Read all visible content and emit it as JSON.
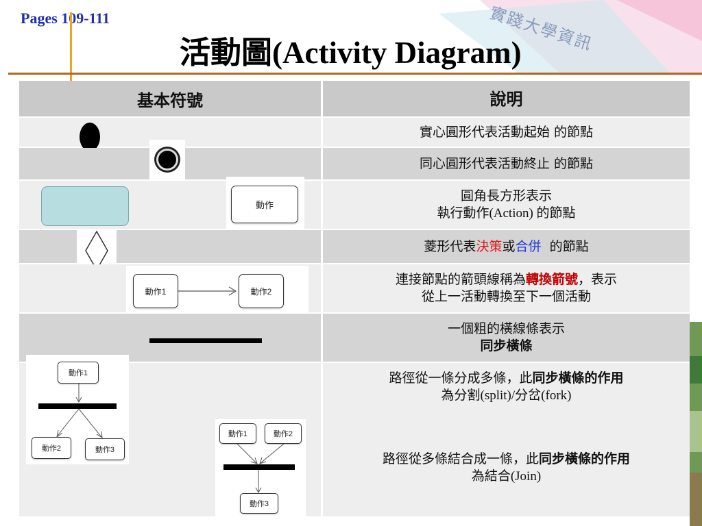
{
  "header": {
    "pages": "Pages 109-111",
    "title": "活動圖(Activity Diagram)",
    "watermark": "實踐大學資訊"
  },
  "table": {
    "col1_header": "基本符號",
    "col2_header": "說明",
    "rows": [
      {
        "desc": "實心圓形代表活動起始 的節點"
      },
      {
        "desc": "同心圓形代表活動終止 的節點"
      },
      {
        "desc_line1": "圓角長方形表示",
        "desc_line2": "執行動作(Action) 的節點",
        "action_label": "動作"
      },
      {
        "desc_a": "菱形代表",
        "desc_decision": "決策",
        "desc_or": "或",
        "desc_merge": "合併",
        "desc_b": "  的節點"
      },
      {
        "desc_a": "連接節點的箭頭線稱為",
        "desc_transition": "轉換箭號",
        "desc_b": "，表示",
        "desc_line2": "從上一活動轉換至下一個活動",
        "node1": "動作1",
        "node2": "動作2"
      },
      {
        "desc_line1": "一個粗的橫線條表示",
        "desc_line2": "同步橫條"
      },
      {
        "fork_a": "路徑從一條分成多條，此",
        "fork_b": "同步橫條的作用",
        "fork_line2": "為分割(split)/分岔(fork)",
        "join_a": "路徑從多條結合成一條，此",
        "join_b": "同步橫條的作用",
        "join_line2": "為結合(Join)",
        "fork_nodes": [
          "動作1",
          "動作2",
          "動作3"
        ],
        "join_nodes": [
          "動作1",
          "動作2",
          "動作3"
        ]
      }
    ]
  },
  "colors": {
    "pages_text": "#1f2fa8",
    "accent_orange": "#f2a31c",
    "rule_brown": "#b5651d",
    "decision_red": "#e0161a",
    "merge_blue": "#1b39d8",
    "transition_red": "#c00000",
    "action_fill": "#b7dde0"
  }
}
